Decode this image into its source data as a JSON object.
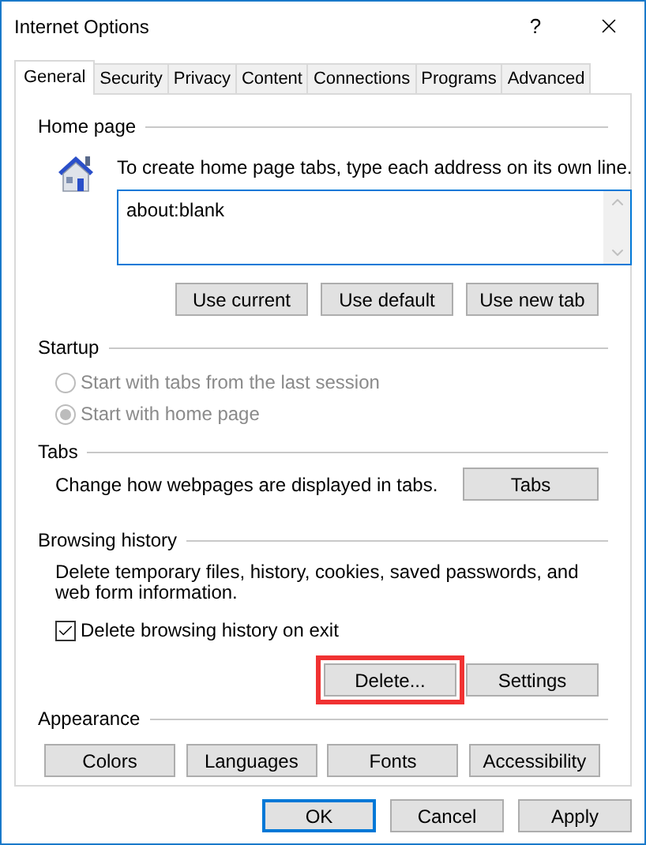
{
  "window": {
    "title": "Internet Options",
    "help": "?"
  },
  "tabs": [
    {
      "label": "General",
      "selected": true
    },
    {
      "label": "Security",
      "selected": false
    },
    {
      "label": "Privacy",
      "selected": false
    },
    {
      "label": "Content",
      "selected": false
    },
    {
      "label": "Connections",
      "selected": false
    },
    {
      "label": "Programs",
      "selected": false
    },
    {
      "label": "Advanced",
      "selected": false
    }
  ],
  "home_page": {
    "legend": "Home page",
    "description": "To create home page tabs, type each address on its own line.",
    "addresses": "about:blank",
    "buttons": [
      {
        "label": "Use current",
        "highlighted": false
      },
      {
        "label": "Use default",
        "highlighted": false
      },
      {
        "label": "Use new tab",
        "highlighted": false
      }
    ]
  },
  "startup": {
    "legend": "Startup",
    "options": [
      {
        "label": "Start with tabs from the last session",
        "selected": false,
        "disabled": true
      },
      {
        "label": "Start with home page",
        "selected": true,
        "disabled": true
      }
    ]
  },
  "tabs_section": {
    "legend": "Tabs",
    "description": "Change how webpages are displayed in tabs.",
    "button": {
      "label": "Tabs",
      "highlighted": false
    }
  },
  "browsing_history": {
    "legend": "Browsing history",
    "description": "Delete temporary files, history, cookies, saved passwords, and web form information.",
    "checkbox": {
      "label": "Delete browsing history on exit",
      "checked": true
    },
    "buttons": [
      {
        "label": "Delete...",
        "highlighted": true
      },
      {
        "label": "Settings",
        "highlighted": false
      }
    ]
  },
  "appearance": {
    "legend": "Appearance",
    "buttons": [
      {
        "label": "Colors",
        "highlighted": false
      },
      {
        "label": "Languages",
        "highlighted": false
      },
      {
        "label": "Fonts",
        "highlighted": false
      },
      {
        "label": "Accessibility",
        "highlighted": false
      }
    ]
  },
  "footer_buttons": [
    {
      "label": "OK",
      "default": true
    },
    {
      "label": "Cancel",
      "default": false
    },
    {
      "label": "Apply",
      "default": false
    }
  ]
}
